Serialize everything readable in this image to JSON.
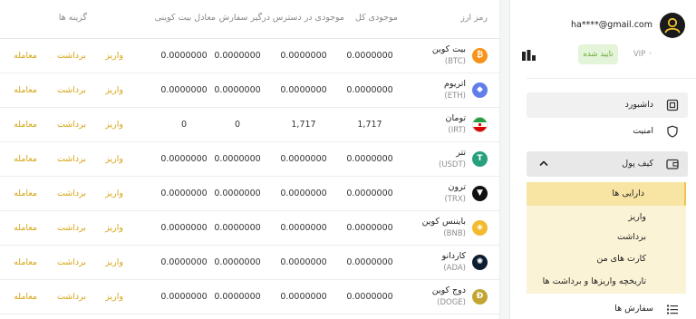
{
  "table": {
    "headers": {
      "asset": "رمز ارز",
      "total": "موجودی کل",
      "available": "موجودی در دسترس",
      "in_orders": "درگیر سفارش",
      "btc_equiv": "معادل بیت کوینی",
      "options": "گزینه ها"
    },
    "actions": {
      "deposit": "واریز",
      "withdraw": "برداشت",
      "trade": "معامله"
    },
    "rows": [
      {
        "name": "بیت کوین",
        "symbol": "(BTC)",
        "icon": "bitcoin-icon",
        "icon_glyph": "₿",
        "color": "#f7931a",
        "total": "0.0000000",
        "available": "0.0000000",
        "in_orders": "0.0000000",
        "btc_equiv": "0.0000000"
      },
      {
        "name": "اتریوم",
        "symbol": "(ETH)",
        "icon": "ethereum-icon",
        "icon_glyph": "◆",
        "color": "#627eea",
        "total": "0.0000000",
        "available": "0.0000000",
        "in_orders": "0.0000000",
        "btc_equiv": "0.0000000"
      },
      {
        "name": "تومان",
        "symbol": "(IRT)",
        "icon": "iran-flag-icon",
        "icon_glyph": "",
        "color": "#ffffff",
        "total": "1,717",
        "available": "1,717",
        "in_orders": "0",
        "btc_equiv": "0"
      },
      {
        "name": "تتر",
        "symbol": "(USDT)",
        "icon": "tether-icon",
        "icon_glyph": "T",
        "color": "#26a17b",
        "total": "0.0000000",
        "available": "0.0000000",
        "in_orders": "0.0000000",
        "btc_equiv": "0.0000000"
      },
      {
        "name": "ترون",
        "symbol": "(TRX)",
        "icon": "tron-icon",
        "icon_glyph": "▼",
        "color": "#111111",
        "total": "0.0000000",
        "available": "0.0000000",
        "in_orders": "0.0000000",
        "btc_equiv": "0.0000000"
      },
      {
        "name": "بایننس کوین",
        "symbol": "(BNB)",
        "icon": "binance-icon",
        "icon_glyph": "◈",
        "color": "#f3ba2f",
        "total": "0.0000000",
        "available": "0.0000000",
        "in_orders": "0.0000000",
        "btc_equiv": "0.0000000"
      },
      {
        "name": "کاردانو",
        "symbol": "(ADA)",
        "icon": "cardano-icon",
        "icon_glyph": "✺",
        "color": "#0d1e30",
        "total": "0.0000000",
        "available": "0.0000000",
        "in_orders": "0.0000000",
        "btc_equiv": "0.0000000"
      },
      {
        "name": "دوج کوین",
        "symbol": "(DOGE)",
        "icon": "dogecoin-icon",
        "icon_glyph": "Ð",
        "color": "#c2a633",
        "total": "0.0000000",
        "available": "0.0000000",
        "in_orders": "0.0000000",
        "btc_equiv": "0.0000000"
      }
    ]
  },
  "sidebar": {
    "email": "ha****@gmail.com",
    "vip": "VIP ◦",
    "verified": "تایید شده",
    "menu": {
      "dashboard": "داشبورد",
      "security": "امنیت",
      "wallet": "کیف پول",
      "orders": "سفارش ها"
    },
    "wallet_sub": [
      "دارایی ها",
      "واریز",
      "برداشت",
      "کارت های من",
      "تاریخچه واریزها و برداشت ها"
    ]
  },
  "colors": {
    "accent": "#d6a515",
    "active_bg": "#f8e4a3",
    "sub_bg": "#fbf3d6",
    "verified_green": "#6da83a"
  }
}
